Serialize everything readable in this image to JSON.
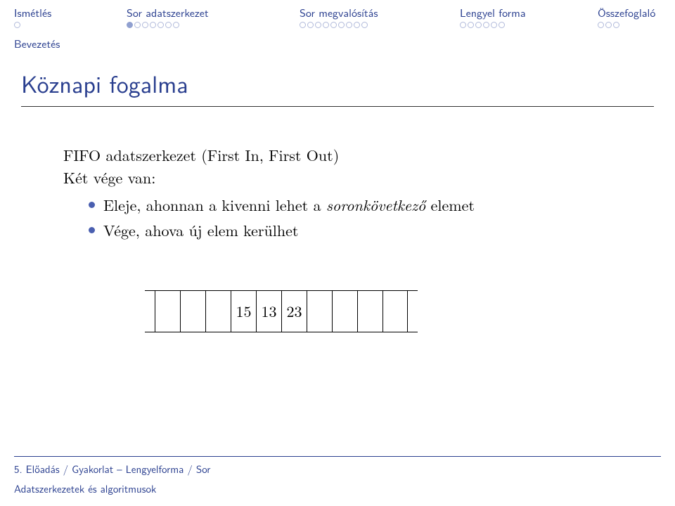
{
  "nav": {
    "items": [
      {
        "label": "Ismétlés",
        "dots": 1,
        "current": -1
      },
      {
        "label": "Sor adatszerkezet",
        "dots": 7,
        "current": 0
      },
      {
        "label": "Sor megvalósítás",
        "dots": 9,
        "current": -1
      },
      {
        "label": "Lengyel forma",
        "dots": 6,
        "current": -1
      },
      {
        "label": "Összefoglaló",
        "dots": 3,
        "current": -1
      }
    ]
  },
  "subsection": "Bevezetés",
  "title": "Köznapi fogalma",
  "body": {
    "line1": "FIFO adatszerkezet (First In, First Out)",
    "line2": "Két vége van:",
    "bullets": [
      {
        "pre": "Eleje, ahonnan a kivenni lehet a ",
        "em": "soronkövetkező",
        "post": " elemet"
      },
      {
        "pre": "Vége, ahova új elem kerülhet",
        "em": "",
        "post": ""
      }
    ]
  },
  "queue": {
    "slots": 10,
    "filled_start": 3,
    "values": [
      "15",
      "13",
      "23"
    ]
  },
  "footer": {
    "line1": "5. Előadás / Gyakorlat – Lengyelforma / Sor",
    "line2": "Adatszerkezetek és algoritmusok"
  }
}
